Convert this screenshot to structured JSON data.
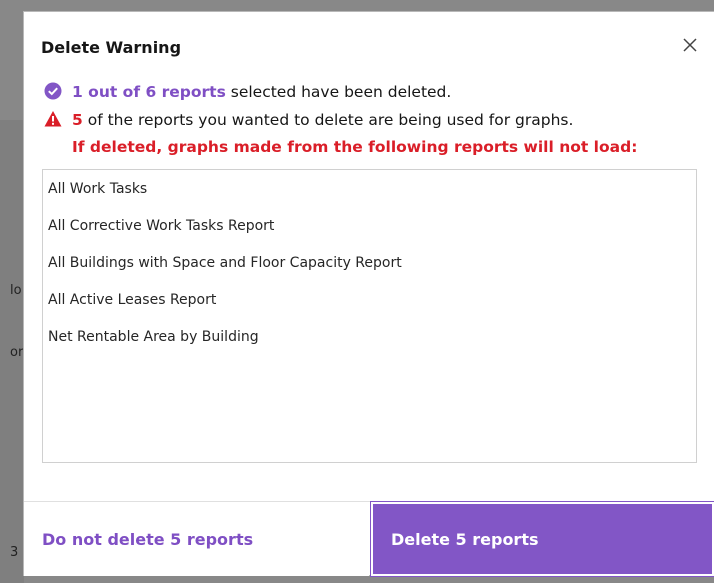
{
  "dialog": {
    "title": "Delete Warning",
    "close_icon": "close-icon",
    "success_count_text": "1 out of 6 reports",
    "success_rest_text": " selected have been deleted.",
    "warning_count": "5",
    "warning_rest_text": " of the reports you wanted to delete are being used for graphs.",
    "warning_note": "If deleted, graphs made from the following reports will not load:",
    "reports": [
      "All Work Tasks",
      "All Corrective Work Tasks Report",
      "All Buildings with Space and Floor Capacity Report",
      "All Active Leases Report",
      "Net Rentable Area by Building"
    ],
    "cancel_label": "Do not delete 5 reports",
    "confirm_label": "Delete 5 reports"
  },
  "background": {
    "fragment_1": "lo",
    "fragment_2": "or",
    "fragment_3": "3"
  },
  "colors": {
    "accent": "#8256c6",
    "danger": "#da1e28"
  }
}
